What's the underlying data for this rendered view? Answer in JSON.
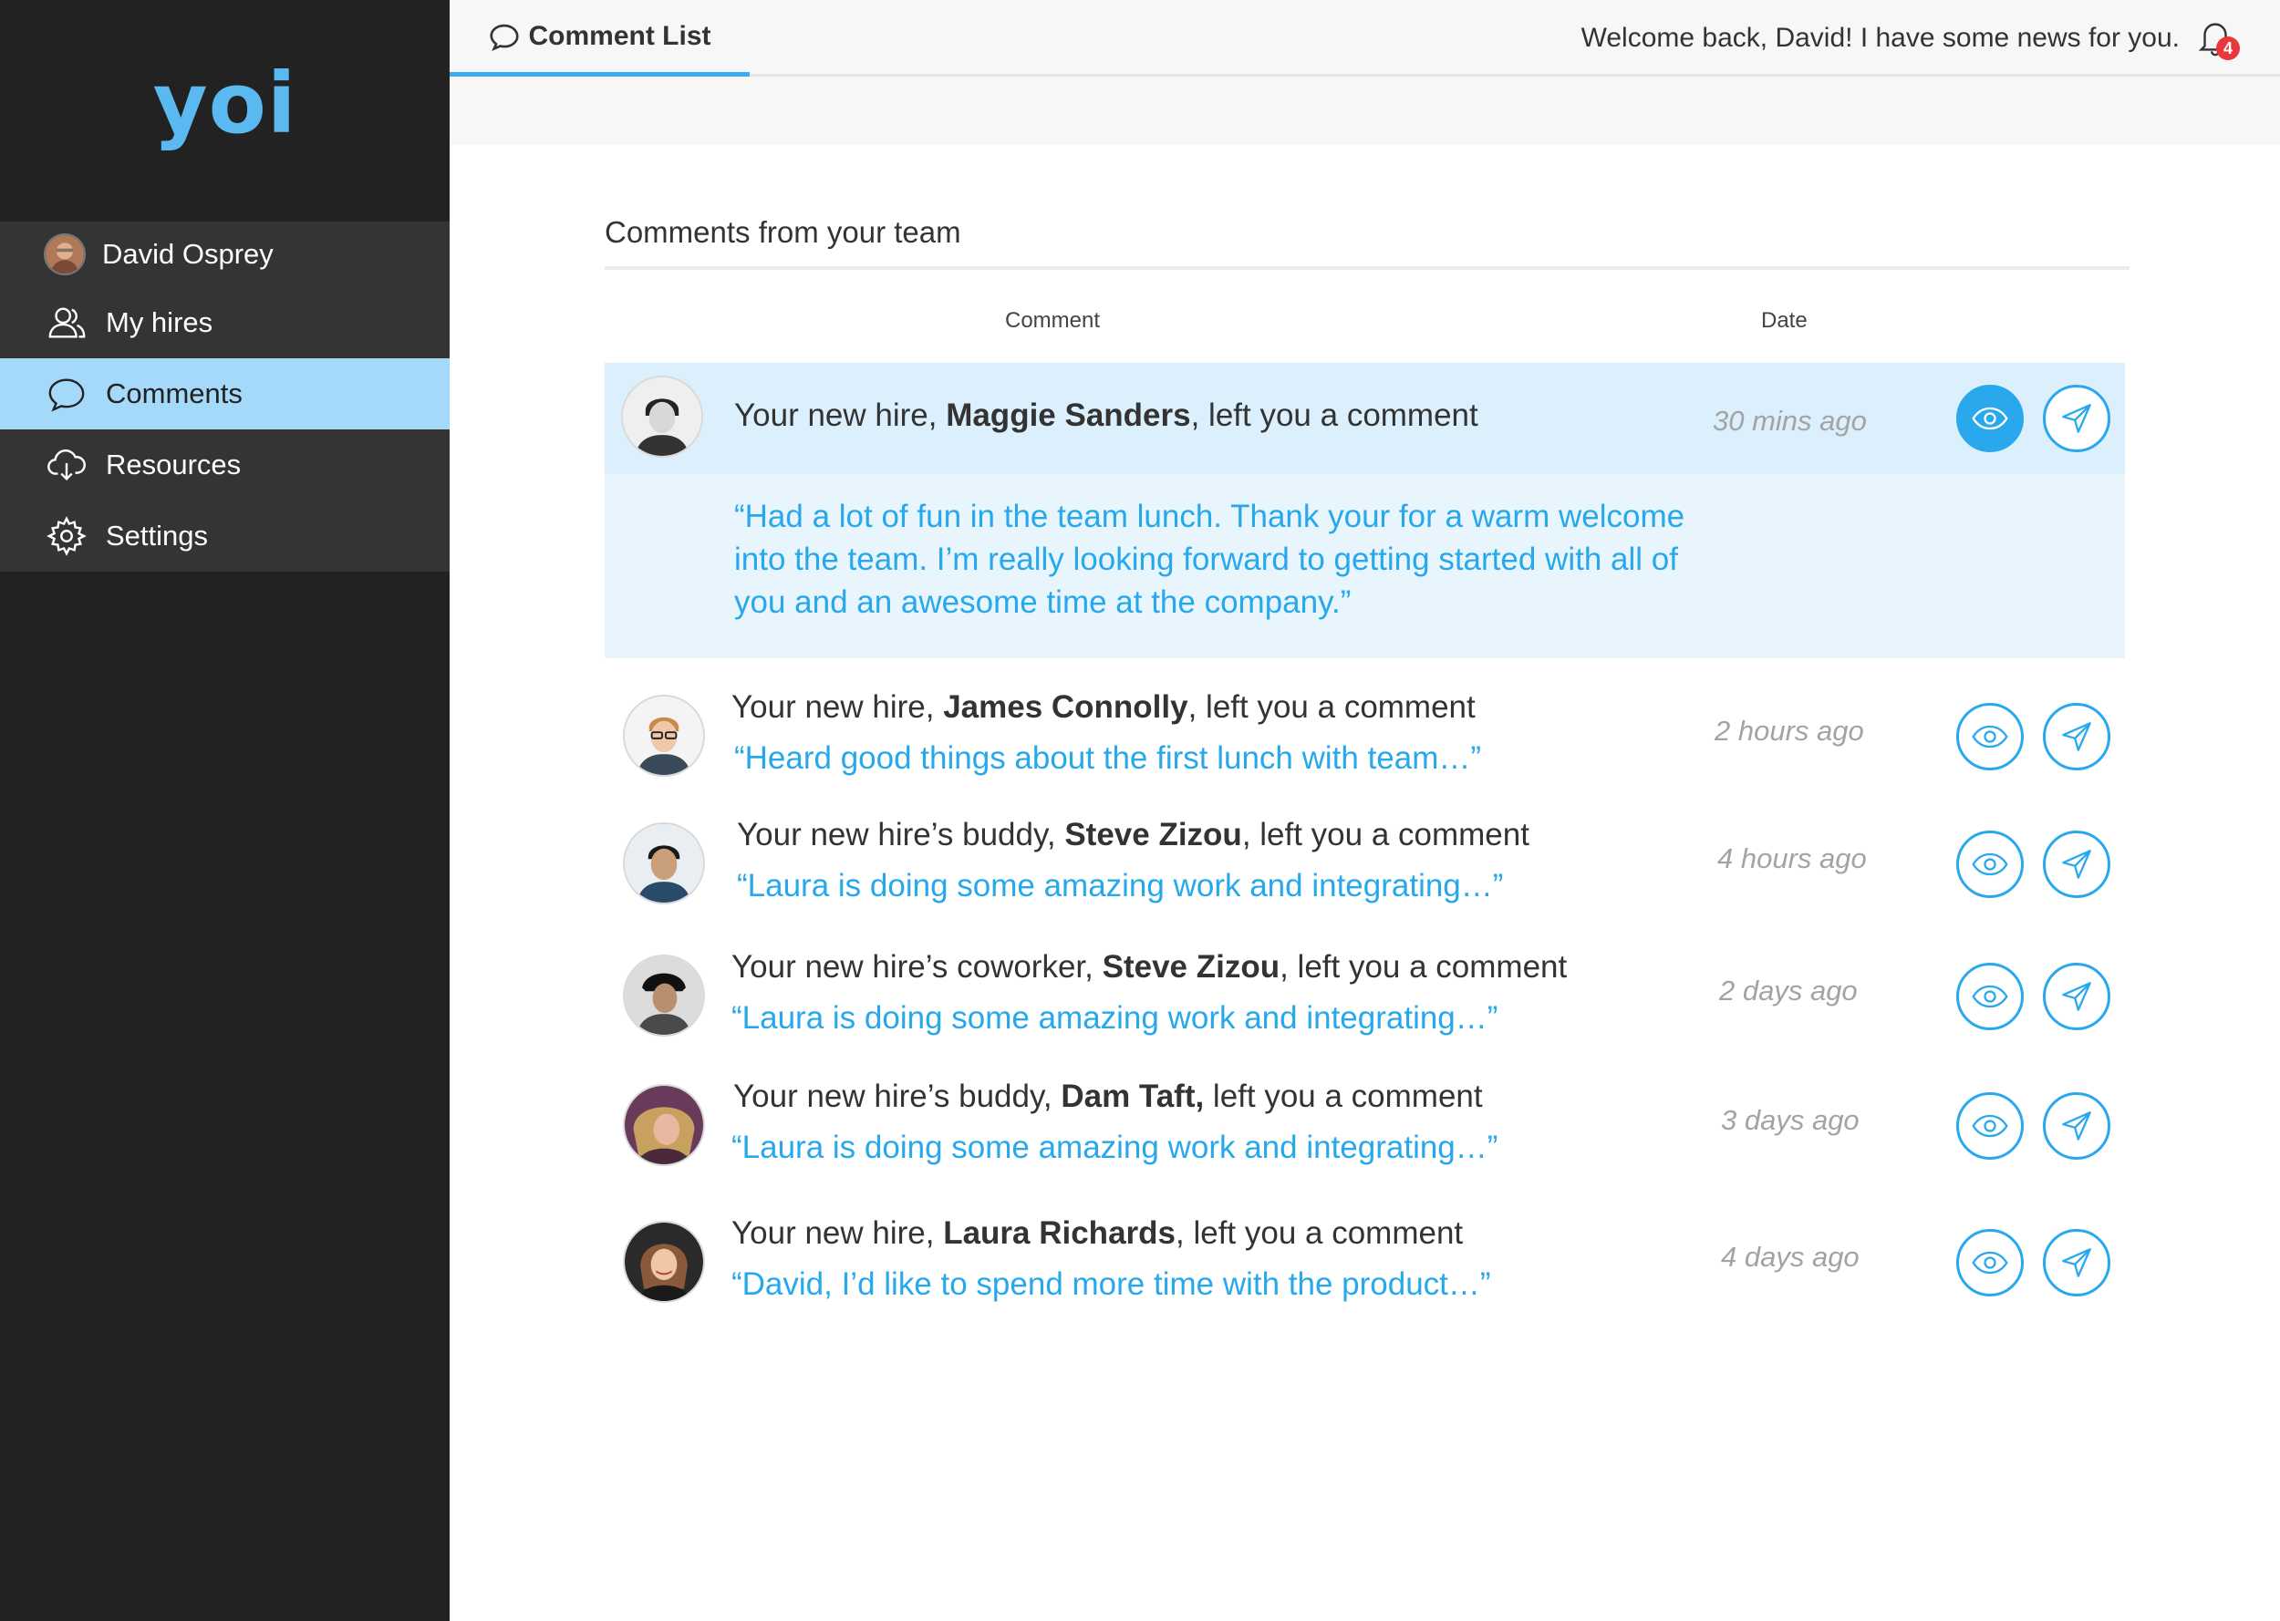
{
  "app": {
    "logo": "yoi"
  },
  "sidebar": {
    "user": {
      "name": "David Osprey"
    },
    "items": [
      {
        "label": "My hires",
        "icon": "users-icon"
      },
      {
        "label": "Comments",
        "icon": "speech-bubble-icon",
        "active": true
      },
      {
        "label": "Resources",
        "icon": "cloud-download-icon"
      },
      {
        "label": "Settings",
        "icon": "gear-icon"
      }
    ]
  },
  "header": {
    "tab_label": "Comment List",
    "welcome": "Welcome back, David! I have some news for you.",
    "notification_count": "4"
  },
  "main": {
    "section_title": "Comments from your team",
    "columns": {
      "comment": "Comment",
      "date": "Date"
    },
    "rows": [
      {
        "prefix": "Your new hire, ",
        "name": "Maggie Sanders",
        "suffix": ", left you a comment",
        "quote": "“Had a lot of fun in the team lunch. Thank your for a warm welcome into the team. I’m really looking forward to getting started with all of you and an awesome time at the company.”",
        "date": "30 mins ago",
        "expanded": true
      },
      {
        "prefix": "Your new hire, ",
        "name": "James Connolly",
        "suffix": ", left you a comment",
        "quote": "“Heard good things about the first lunch with team…”",
        "date": "2 hours ago"
      },
      {
        "prefix": "Your new hire’s buddy, ",
        "name": "Steve Zizou",
        "suffix": ", left you a comment",
        "quote": "“Laura is doing some amazing work and integrating…”",
        "date": "4 hours ago"
      },
      {
        "prefix": "Your new hire’s coworker, ",
        "name": "Steve Zizou",
        "suffix": ", left you a comment",
        "quote": "“Laura is doing some amazing work and integrating…”",
        "date": "2 days ago"
      },
      {
        "prefix": "Your new hire’s buddy, ",
        "name": "Dam Taft,",
        "suffix": " left you a comment",
        "quote": "“Laura is doing some amazing work and integrating…”",
        "date": "3 days ago"
      },
      {
        "prefix": "Your new hire, ",
        "name": "Laura Richards",
        "suffix": ", left you a comment",
        "quote": "“David, I’d like to spend more time with the product…”",
        "date": "4 days ago"
      }
    ]
  },
  "colors": {
    "accent": "#2aa8ee",
    "sidebar_bg": "#222222",
    "active_nav": "#a5d9fa",
    "quote": "#27a8ea",
    "badge": "#e8383d"
  }
}
